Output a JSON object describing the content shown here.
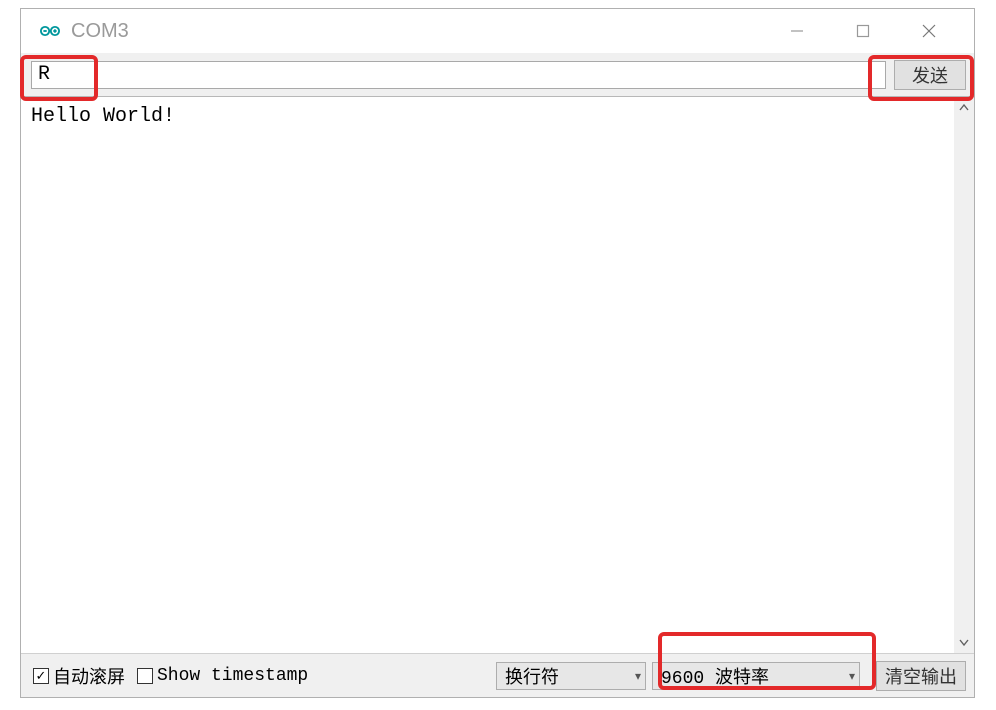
{
  "titlebar": {
    "title": "COM3"
  },
  "input": {
    "value": "R",
    "send_label": "发送"
  },
  "output": {
    "content": "Hello World!"
  },
  "bottom": {
    "autoscroll_label": "自动滚屏",
    "autoscroll_checked": true,
    "timestamp_label": "Show timestamp",
    "timestamp_checked": false,
    "newline_selected": "换行符",
    "baud_selected": "9600 波特率",
    "clear_label": "清空输出"
  }
}
